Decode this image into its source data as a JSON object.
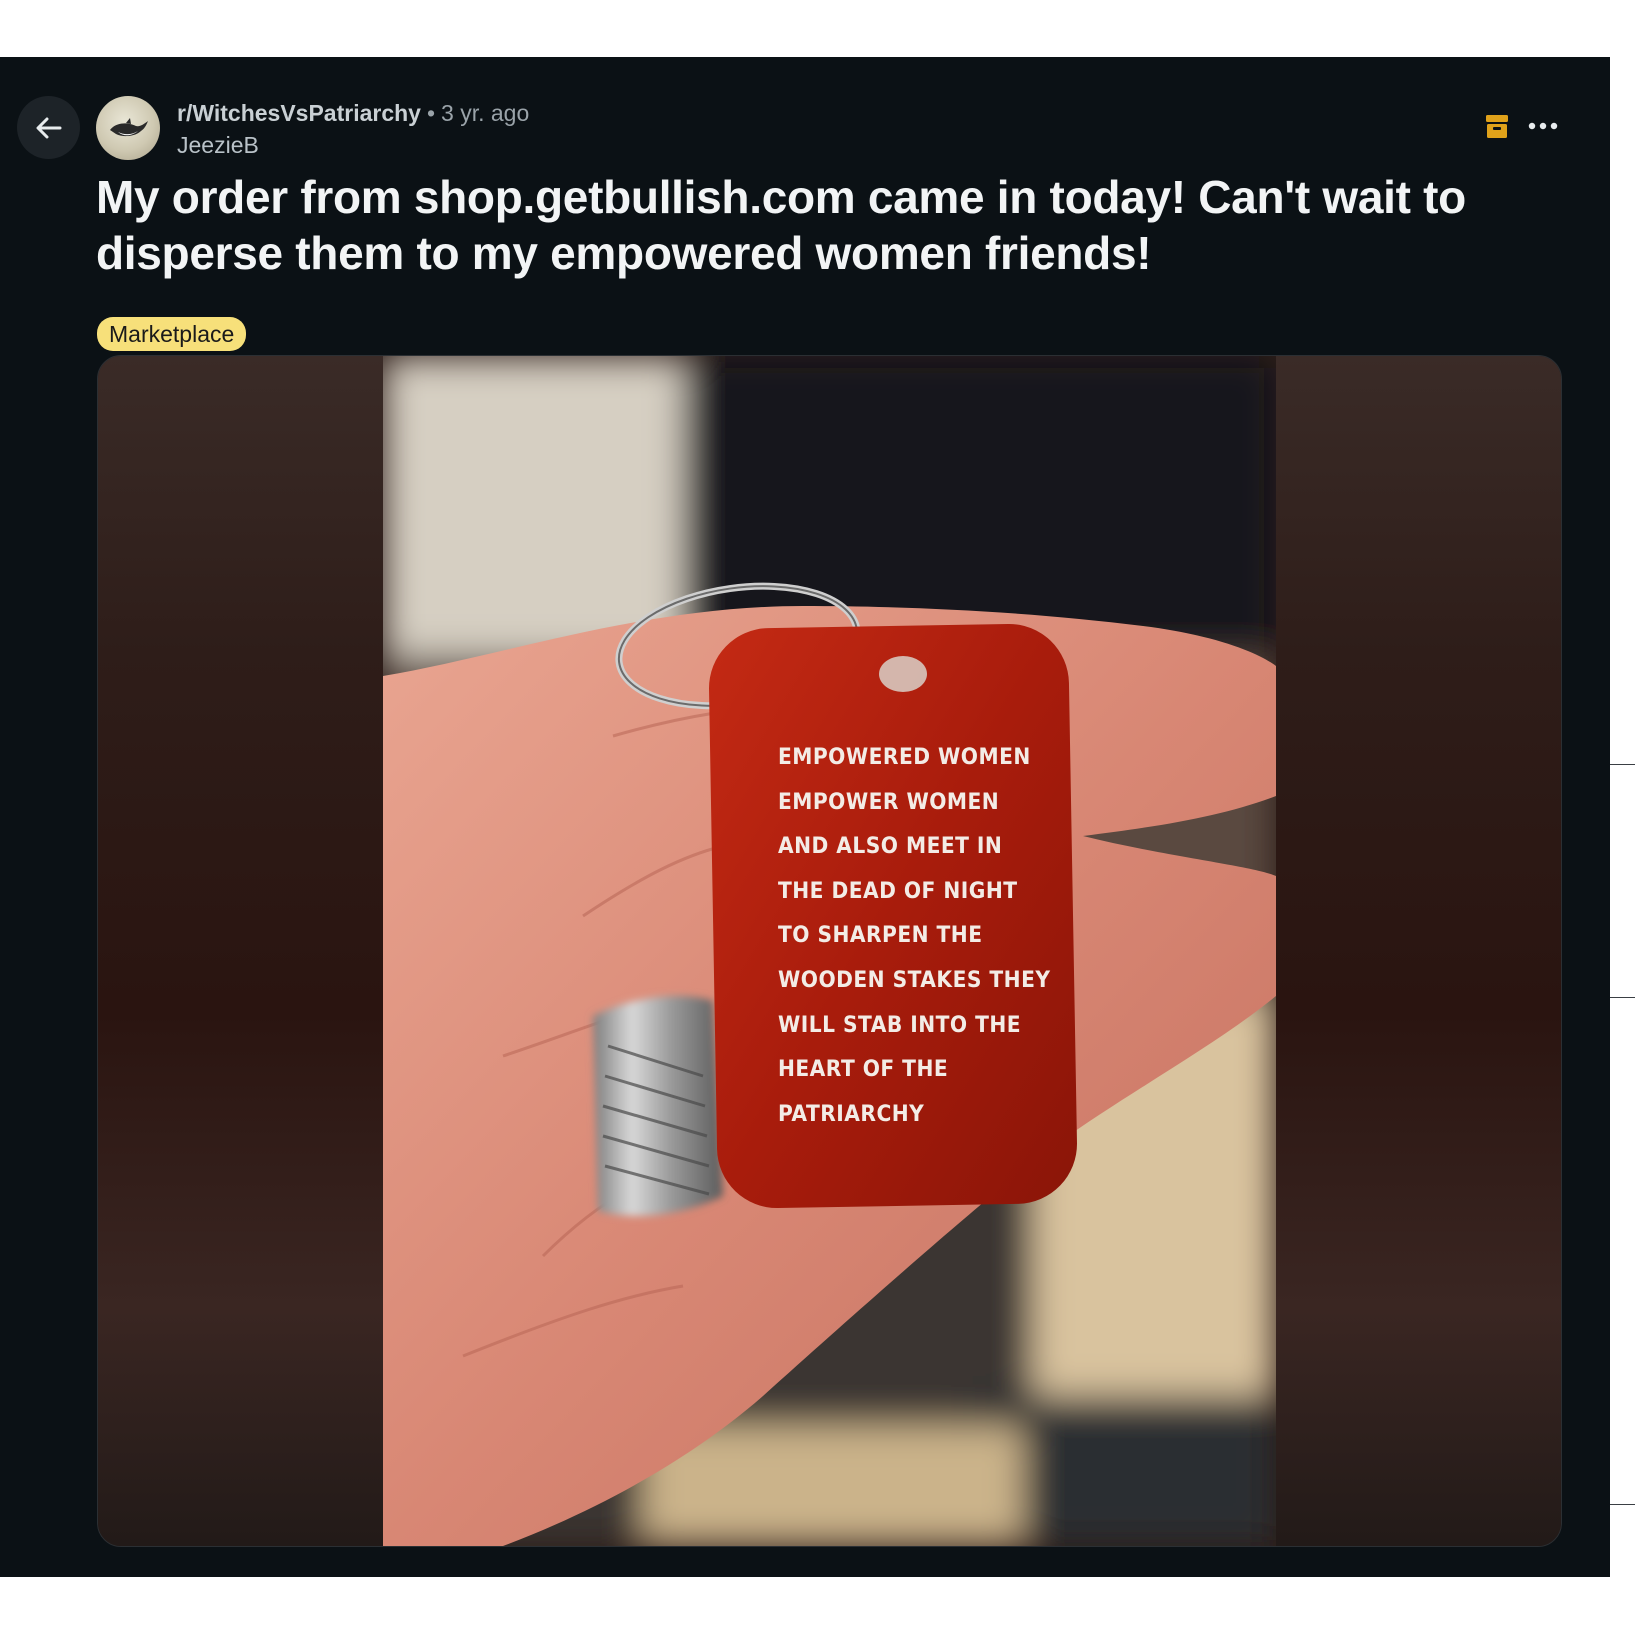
{
  "post": {
    "subreddit": "r/WitchesVsPatriarchy",
    "separator": "•",
    "time_ago": "3 yr. ago",
    "author": "JeezieB",
    "title": "My order from shop.getbullish.com came in today! Can't wait to disperse them to my empowered women friends!",
    "flair": "Marketplace"
  },
  "image": {
    "keychain_text": [
      "EMPOWERED WOMEN",
      "EMPOWER WOMEN",
      "AND ALSO MEET IN",
      "THE DEAD OF NIGHT",
      "TO SHARPEN THE",
      "WOODEN STAKES THEY",
      "WILL STAB INTO THE",
      "HEART OF THE",
      "PATRIARCHY"
    ]
  },
  "icons": {
    "back": "arrow-left-icon",
    "archive": "archive-icon",
    "more": "more-horizontal-icon"
  },
  "colors": {
    "background": "#0b1115",
    "flair_bg": "#f7e07a",
    "archive_icon": "#e0a21a",
    "keychain": "#b3200f"
  }
}
